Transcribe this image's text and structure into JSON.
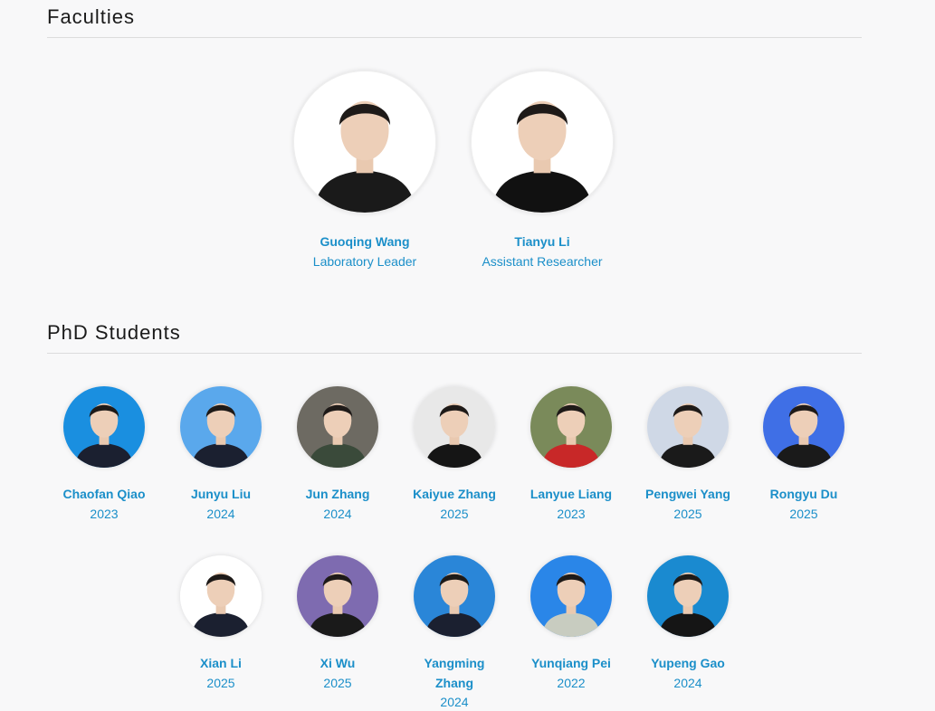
{
  "sections": {
    "faculties_title": "Faculties",
    "phd_title": "PhD Students"
  },
  "faculties": [
    {
      "name": "Guoqing Wang",
      "role": "Laboratory Leader",
      "bg": "#ffffff",
      "shirt": "#1a1a1a"
    },
    {
      "name": "Tianyu Li",
      "role": "Assistant Researcher",
      "bg": "#ffffff",
      "shirt": "#111111"
    }
  ],
  "students": [
    {
      "name": "Chaofan Qiao",
      "year": "2023",
      "bg": "#1a8fe0",
      "shirt": "#1b2030"
    },
    {
      "name": "Junyu Liu",
      "year": "2024",
      "bg": "#5aa8ec",
      "shirt": "#1b2030"
    },
    {
      "name": "Jun Zhang",
      "year": "2024",
      "bg": "#6d6a62",
      "shirt": "#3a4a3a"
    },
    {
      "name": "Kaiyue Zhang",
      "year": "2025",
      "bg": "#e8e8e8",
      "shirt": "#151515"
    },
    {
      "name": "Lanyue Liang",
      "year": "2023",
      "bg": "#7a8a5a",
      "shirt": "#c82828"
    },
    {
      "name": "Pengwei Yang",
      "year": "2025",
      "bg": "#cfd8e6",
      "shirt": "#1a1a1a"
    },
    {
      "name": "Rongyu Du",
      "year": "2025",
      "bg": "#3f6fe6",
      "shirt": "#1a1a1a"
    },
    {
      "name": "Xian Li",
      "year": "2025",
      "bg": "#ffffff",
      "shirt": "#1b2030"
    },
    {
      "name": "Xi Wu",
      "year": "2025",
      "bg": "#7e6bb0",
      "shirt": "#1a1a1a"
    },
    {
      "name": "Yangming Zhang",
      "year": "2024",
      "bg": "#2a86d8",
      "shirt": "#1b2030"
    },
    {
      "name": "Yunqiang Pei",
      "year": "2022",
      "bg": "#2a86e8",
      "shirt": "#c8ccc0"
    },
    {
      "name": "Yupeng Gao",
      "year": "2024",
      "bg": "#1a8ad0",
      "shirt": "#151515"
    }
  ]
}
